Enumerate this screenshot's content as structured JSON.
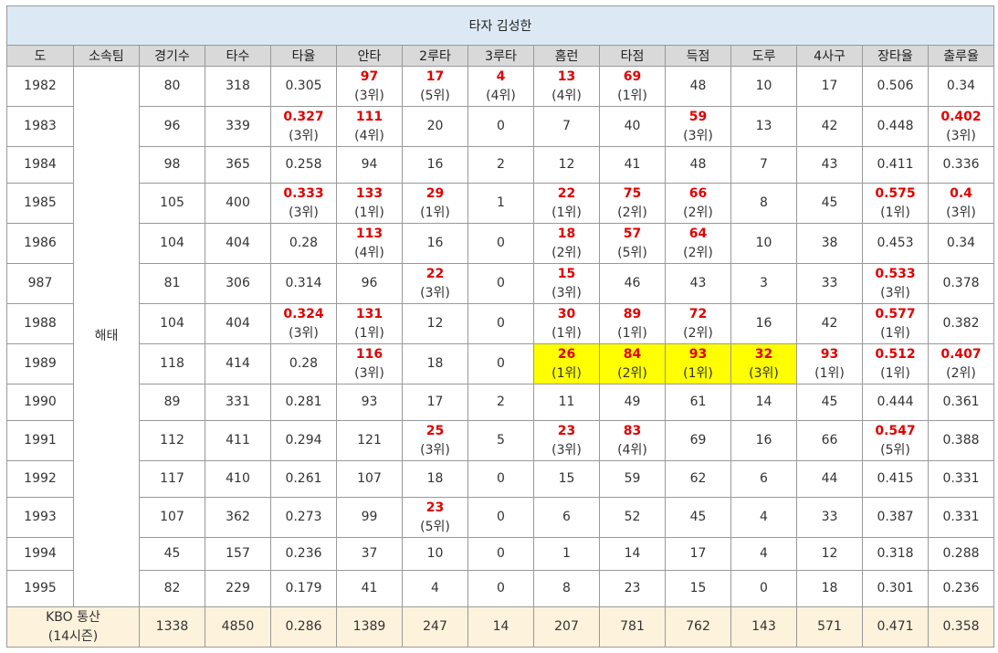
{
  "title": "타자 김성한",
  "headers": [
    "도",
    "소속팀",
    "경기수",
    "타수",
    "타율",
    "안타",
    "2루타",
    "3루타",
    "홈런",
    "타점",
    "득점",
    "도루",
    "4사구",
    "장타율",
    "출루율"
  ],
  "team": "해태",
  "colors": {
    "header_bg": "#d9d9d9",
    "title_bg": "#dce9f5",
    "highlight": "#ffff00",
    "leader_text": "#e00000",
    "total_bg": "#fdf2dc"
  },
  "rows": [
    {
      "year": "1982",
      "cells": [
        {
          "v": "80"
        },
        {
          "v": "318"
        },
        {
          "v": "0.305"
        },
        {
          "v": "97",
          "r": "(3위)"
        },
        {
          "v": "17",
          "r": "(5위)"
        },
        {
          "v": "4",
          "r": "(4위)"
        },
        {
          "v": "13",
          "r": "(4위)"
        },
        {
          "v": "69",
          "r": "(1위)"
        },
        {
          "v": "48"
        },
        {
          "v": "10"
        },
        {
          "v": "17"
        },
        {
          "v": "0.506"
        },
        {
          "v": "0.34"
        }
      ]
    },
    {
      "year": "1983",
      "cells": [
        {
          "v": "96"
        },
        {
          "v": "339"
        },
        {
          "v": "0.327",
          "r": "(3위)"
        },
        {
          "v": "111",
          "r": "(4위)"
        },
        {
          "v": "20"
        },
        {
          "v": "0"
        },
        {
          "v": "7"
        },
        {
          "v": "40"
        },
        {
          "v": "59",
          "r": "(3위)"
        },
        {
          "v": "13"
        },
        {
          "v": "42"
        },
        {
          "v": "0.448"
        },
        {
          "v": "0.402",
          "r": "(3위)"
        }
      ]
    },
    {
      "year": "1984",
      "cells": [
        {
          "v": "98"
        },
        {
          "v": "365"
        },
        {
          "v": "0.258"
        },
        {
          "v": "94"
        },
        {
          "v": "16"
        },
        {
          "v": "2"
        },
        {
          "v": "12"
        },
        {
          "v": "41"
        },
        {
          "v": "48"
        },
        {
          "v": "7"
        },
        {
          "v": "43"
        },
        {
          "v": "0.411"
        },
        {
          "v": "0.336"
        }
      ]
    },
    {
      "year": "1985",
      "cells": [
        {
          "v": "105"
        },
        {
          "v": "400"
        },
        {
          "v": "0.333",
          "r": "(3위)"
        },
        {
          "v": "133",
          "r": "(1위)"
        },
        {
          "v": "29",
          "r": "(1위)"
        },
        {
          "v": "1"
        },
        {
          "v": "22",
          "r": "(1위)"
        },
        {
          "v": "75",
          "r": "(2위)"
        },
        {
          "v": "66",
          "r": "(2위)"
        },
        {
          "v": "8"
        },
        {
          "v": "45"
        },
        {
          "v": "0.575",
          "r": "(1위)"
        },
        {
          "v": "0.4",
          "r": "(3위)"
        }
      ]
    },
    {
      "year": "1986",
      "cells": [
        {
          "v": "104"
        },
        {
          "v": "404"
        },
        {
          "v": "0.28"
        },
        {
          "v": "113",
          "r": "(4위)"
        },
        {
          "v": "16"
        },
        {
          "v": "0"
        },
        {
          "v": "18",
          "r": "(2위)"
        },
        {
          "v": "57",
          "r": "(5위)"
        },
        {
          "v": "64",
          "r": "(2위)"
        },
        {
          "v": "10"
        },
        {
          "v": "38"
        },
        {
          "v": "0.453"
        },
        {
          "v": "0.34"
        }
      ]
    },
    {
      "year": "987",
      "cells": [
        {
          "v": "81"
        },
        {
          "v": "306"
        },
        {
          "v": "0.314"
        },
        {
          "v": "96"
        },
        {
          "v": "22",
          "r": "(3위)"
        },
        {
          "v": "0"
        },
        {
          "v": "15",
          "r": "(3위)"
        },
        {
          "v": "46"
        },
        {
          "v": "43"
        },
        {
          "v": "3"
        },
        {
          "v": "33"
        },
        {
          "v": "0.533",
          "r": "(3위)"
        },
        {
          "v": "0.378"
        }
      ]
    },
    {
      "year": "1988",
      "cells": [
        {
          "v": "104"
        },
        {
          "v": "404"
        },
        {
          "v": "0.324",
          "r": "(3위)"
        },
        {
          "v": "131",
          "r": "(1위)"
        },
        {
          "v": "12"
        },
        {
          "v": "0"
        },
        {
          "v": "30",
          "r": "(1위)"
        },
        {
          "v": "89",
          "r": "(1위)"
        },
        {
          "v": "72",
          "r": "(2위)"
        },
        {
          "v": "16"
        },
        {
          "v": "42"
        },
        {
          "v": "0.577",
          "r": "(1위)"
        },
        {
          "v": "0.382"
        }
      ]
    },
    {
      "year": "1989",
      "cells": [
        {
          "v": "118"
        },
        {
          "v": "414"
        },
        {
          "v": "0.28"
        },
        {
          "v": "116",
          "r": "(3위)"
        },
        {
          "v": "18"
        },
        {
          "v": "0"
        },
        {
          "v": "26",
          "r": "(1위)",
          "hl": true
        },
        {
          "v": "84",
          "r": "(2위)",
          "hl": true
        },
        {
          "v": "93",
          "r": "(1위)",
          "hl": true
        },
        {
          "v": "32",
          "r": "(3위)",
          "hl": true
        },
        {
          "v": "93",
          "r": "(1위)"
        },
        {
          "v": "0.512",
          "r": "(1위)"
        },
        {
          "v": "0.407",
          "r": "(2위)"
        }
      ]
    },
    {
      "year": "1990",
      "cells": [
        {
          "v": "89"
        },
        {
          "v": "331"
        },
        {
          "v": "0.281"
        },
        {
          "v": "93"
        },
        {
          "v": "17"
        },
        {
          "v": "2"
        },
        {
          "v": "11"
        },
        {
          "v": "49"
        },
        {
          "v": "61"
        },
        {
          "v": "14"
        },
        {
          "v": "45"
        },
        {
          "v": "0.444"
        },
        {
          "v": "0.361"
        }
      ]
    },
    {
      "year": "1991",
      "cells": [
        {
          "v": "112"
        },
        {
          "v": "411"
        },
        {
          "v": "0.294"
        },
        {
          "v": "121"
        },
        {
          "v": "25",
          "r": "(3위)"
        },
        {
          "v": "5"
        },
        {
          "v": "23",
          "r": "(3위)"
        },
        {
          "v": "83",
          "r": "(4위)"
        },
        {
          "v": "69"
        },
        {
          "v": "16"
        },
        {
          "v": "66"
        },
        {
          "v": "0.547",
          "r": "(5위)"
        },
        {
          "v": "0.388"
        }
      ]
    },
    {
      "year": "1992",
      "cells": [
        {
          "v": "117"
        },
        {
          "v": "410"
        },
        {
          "v": "0.261"
        },
        {
          "v": "107"
        },
        {
          "v": "18"
        },
        {
          "v": "0"
        },
        {
          "v": "15"
        },
        {
          "v": "59"
        },
        {
          "v": "62"
        },
        {
          "v": "6"
        },
        {
          "v": "44"
        },
        {
          "v": "0.415"
        },
        {
          "v": "0.331"
        }
      ]
    },
    {
      "year": "1993",
      "cells": [
        {
          "v": "107"
        },
        {
          "v": "362"
        },
        {
          "v": "0.273"
        },
        {
          "v": "99"
        },
        {
          "v": "23",
          "r": "(5위)"
        },
        {
          "v": "0"
        },
        {
          "v": "6"
        },
        {
          "v": "52"
        },
        {
          "v": "45"
        },
        {
          "v": "4"
        },
        {
          "v": "33"
        },
        {
          "v": "0.387"
        },
        {
          "v": "0.331"
        }
      ]
    },
    {
      "year": "1994",
      "cells": [
        {
          "v": "45"
        },
        {
          "v": "157"
        },
        {
          "v": "0.236"
        },
        {
          "v": "37"
        },
        {
          "v": "10"
        },
        {
          "v": "0"
        },
        {
          "v": "1"
        },
        {
          "v": "14"
        },
        {
          "v": "17"
        },
        {
          "v": "4"
        },
        {
          "v": "12"
        },
        {
          "v": "0.318"
        },
        {
          "v": "0.288"
        }
      ]
    },
    {
      "year": "1995",
      "cells": [
        {
          "v": "82"
        },
        {
          "v": "229"
        },
        {
          "v": "0.179"
        },
        {
          "v": "41"
        },
        {
          "v": "4"
        },
        {
          "v": "0"
        },
        {
          "v": "8"
        },
        {
          "v": "23"
        },
        {
          "v": "15"
        },
        {
          "v": "0"
        },
        {
          "v": "18"
        },
        {
          "v": "0.301"
        },
        {
          "v": "0.236"
        }
      ]
    }
  ],
  "total": {
    "label_line1": "KBO 통산",
    "label_line2": "(14시즌)",
    "cells": [
      "1338",
      "4850",
      "0.286",
      "1389",
      "247",
      "14",
      "207",
      "781",
      "762",
      "143",
      "571",
      "0.471",
      "0.358"
    ]
  }
}
